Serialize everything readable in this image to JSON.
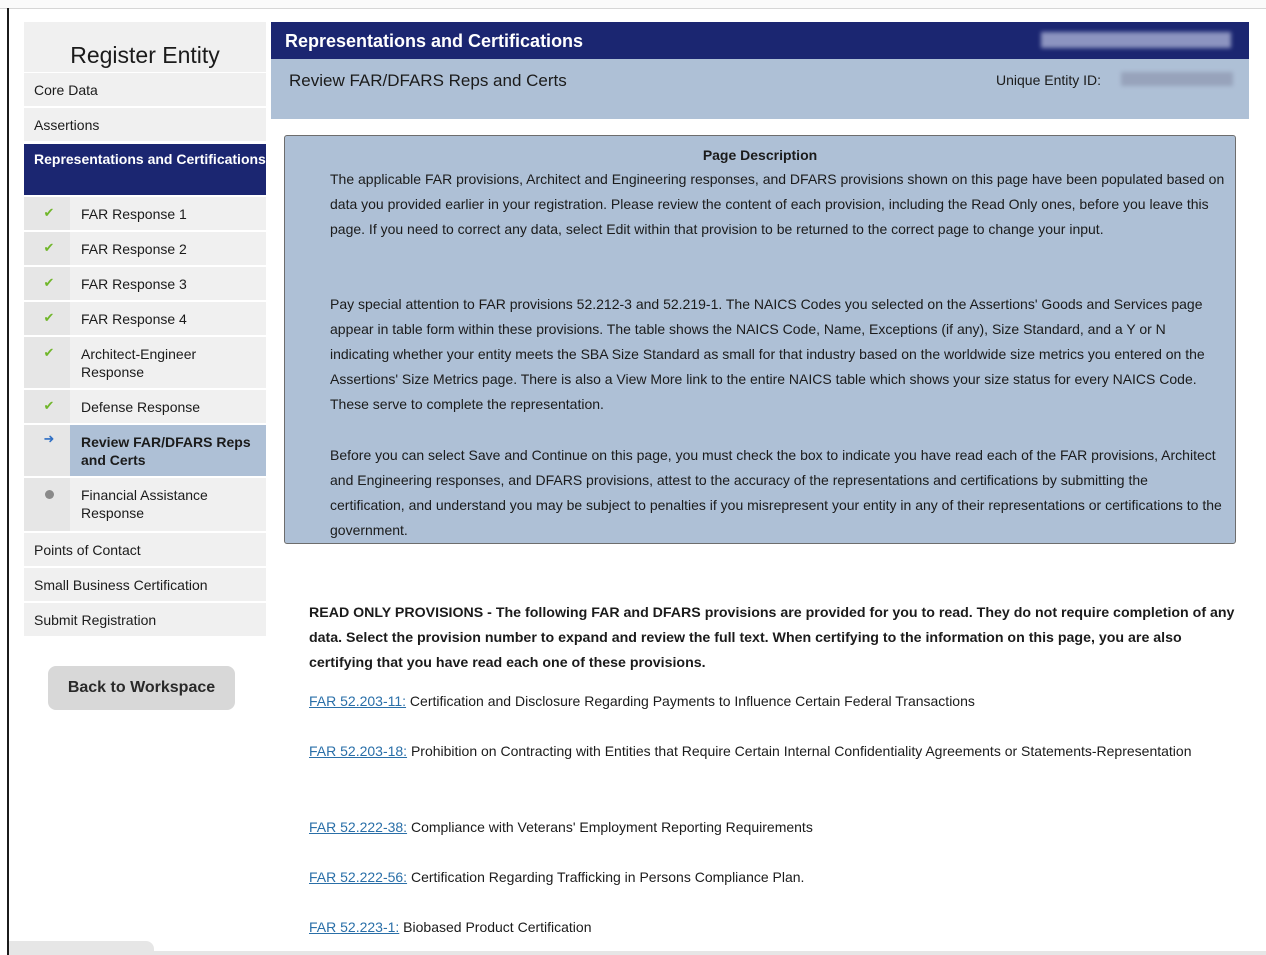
{
  "sidebar": {
    "title": "Register Entity",
    "items": [
      {
        "label": "Core Data"
      },
      {
        "label": "Assertions"
      },
      {
        "label": "Representations and Certifications"
      },
      {
        "label": "Points of Contact"
      },
      {
        "label": "Small Business Certification"
      },
      {
        "label": "Submit Registration"
      }
    ],
    "subitems": [
      {
        "label": "FAR Response 1",
        "status": "complete"
      },
      {
        "label": "FAR Response 2",
        "status": "complete"
      },
      {
        "label": "FAR Response 3",
        "status": "complete"
      },
      {
        "label": "FAR Response 4",
        "status": "complete"
      },
      {
        "label": "Architect-Engineer Response",
        "status": "complete"
      },
      {
        "label": "Defense Response",
        "status": "complete"
      },
      {
        "label": "Review FAR/DFARS Reps and Certs",
        "status": "current"
      },
      {
        "label": "Financial Assistance Response",
        "status": "pending"
      }
    ],
    "back_label": "Back to Workspace"
  },
  "header": {
    "title": "Representations and Certifications",
    "subtitle": "Review FAR/DFARS Reps and Certs",
    "uei_label": "Unique Entity ID:"
  },
  "description": {
    "title": "Page Description",
    "paragraphs": [
      "The applicable FAR provisions, Architect and Engineering responses, and DFARS provisions shown on this page have been populated based on data you provided earlier in your registration. Please review the content of each provision, including the Read Only ones, before you leave this page. If you need to correct any data, select Edit within that provision to be returned to the correct page to change your input.",
      "Pay special attention to FAR provisions 52.212-3 and 52.219-1. The NAICS Codes you selected on the Assertions' Goods and Services page appear in table form within these provisions. The table shows the NAICS Code, Name, Exceptions (if any), Size Standard, and a Y or N indicating whether your entity meets the SBA Size Standard as small for that industry based on the worldwide size metrics you entered on the Assertions' Size Metrics page. There is also a View More link to the entire NAICS table which shows your size status for every NAICS Code. These serve to complete the representation.",
      "Before you can select Save and Continue on this page, you must check the box to indicate you have read each of the FAR provisions, Architect and Engineering responses, and DFARS provisions, attest to the accuracy of the representations and certifications by submitting the certification, and understand you may be subject to penalties if you misrepresent your entity in any of their representations or certifications to the government."
    ]
  },
  "read_only": {
    "text": "READ ONLY PROVISIONS - The following FAR and DFARS provisions are provided for you to read. They do not require completion of any data. Select the provision number to expand and review the full text. When certifying to the information on this page, you are also certifying that you have read each one of these provisions."
  },
  "provisions": [
    {
      "link": "FAR 52.203-11:",
      "text": " Certification and Disclosure Regarding Payments to Influence Certain Federal Transactions"
    },
    {
      "link": "FAR 52.203-18:",
      "text": " Prohibition on Contracting with Entities that Require Certain Internal Confidentiality Agreements or Statements-Representation"
    },
    {
      "link": "FAR 52.222-38:",
      "text": " Compliance with Veterans' Employment Reporting Requirements"
    },
    {
      "link": "FAR 52.222-56:",
      "text": " Certification Regarding Trafficking in Persons Compliance Plan."
    },
    {
      "link": "FAR 52.223-1:",
      "text": " Biobased Product Certification"
    }
  ],
  "colors": {
    "navy": "#1b2671",
    "panel": "#aec0d6",
    "check": "#70b62a",
    "link": "#2a6fa8"
  },
  "icons": {
    "complete": "check-icon",
    "current": "arrow-right-icon",
    "pending": "dot-icon"
  }
}
